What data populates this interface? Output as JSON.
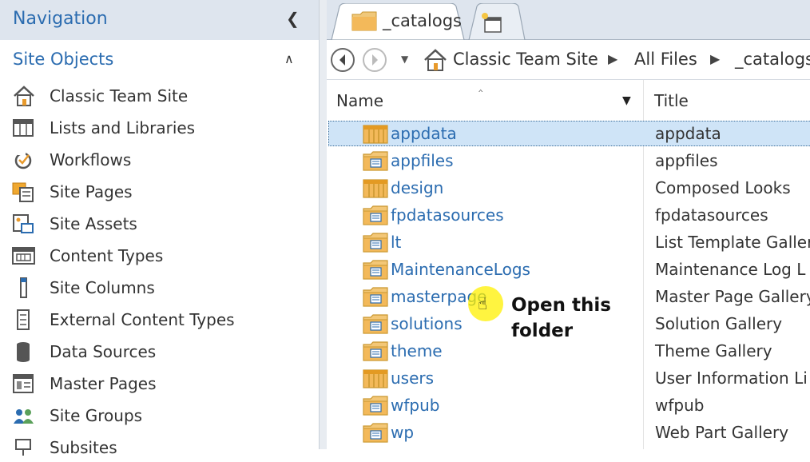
{
  "nav": {
    "title": "Navigation",
    "collapse_icon": "chevron-left-icon",
    "section": "Site Objects",
    "section_icon": "chevron-up-icon",
    "items": [
      {
        "label": "Classic Team Site",
        "icon": "home-icon"
      },
      {
        "label": "Lists and Libraries",
        "icon": "list-icon"
      },
      {
        "label": "Workflows",
        "icon": "workflow-icon"
      },
      {
        "label": "Site Pages",
        "icon": "pages-icon"
      },
      {
        "label": "Site Assets",
        "icon": "assets-icon"
      },
      {
        "label": "Content Types",
        "icon": "content-types-icon"
      },
      {
        "label": "Site Columns",
        "icon": "columns-icon"
      },
      {
        "label": "External Content Types",
        "icon": "external-content-icon"
      },
      {
        "label": "Data Sources",
        "icon": "database-icon"
      },
      {
        "label": "Master Pages",
        "icon": "master-pages-icon"
      },
      {
        "label": "Site Groups",
        "icon": "groups-icon"
      },
      {
        "label": "Subsites",
        "icon": "subsites-icon"
      }
    ]
  },
  "tabs": [
    {
      "label": "_catalogs",
      "icon": "folder-icon",
      "active": true
    },
    {
      "label": "",
      "icon": "new-tab-icon",
      "active": false
    }
  ],
  "breadcrumb": [
    "Classic Team Site",
    "All Files",
    "_catalogs"
  ],
  "columns": {
    "name": "Name",
    "title": "Title"
  },
  "rows": [
    {
      "name": "appdata",
      "title": "appdata",
      "icon": "list-folder-icon",
      "selected": true
    },
    {
      "name": "appfiles",
      "title": "appfiles",
      "icon": "library-folder-icon",
      "selected": false
    },
    {
      "name": "design",
      "title": "Composed Looks",
      "icon": "list-folder-icon",
      "selected": false
    },
    {
      "name": "fpdatasources",
      "title": "fpdatasources",
      "icon": "library-folder-icon",
      "selected": false
    },
    {
      "name": "lt",
      "title": "List Template Galler",
      "icon": "library-folder-icon",
      "selected": false
    },
    {
      "name": "MaintenanceLogs",
      "title": "Maintenance Log L",
      "icon": "library-folder-icon",
      "selected": false
    },
    {
      "name": "masterpage",
      "title": "Master Page Gallery",
      "icon": "library-folder-icon",
      "selected": false
    },
    {
      "name": "solutions",
      "title": "Solution Gallery",
      "icon": "library-folder-icon",
      "selected": false
    },
    {
      "name": "theme",
      "title": "Theme Gallery",
      "icon": "library-folder-icon",
      "selected": false
    },
    {
      "name": "users",
      "title": "User Information Li",
      "icon": "list-folder-icon",
      "selected": false
    },
    {
      "name": "wfpub",
      "title": "wfpub",
      "icon": "library-folder-icon",
      "selected": false
    },
    {
      "name": "wp",
      "title": "Web Part Gallery",
      "icon": "library-folder-icon",
      "selected": false
    }
  ],
  "annotation": {
    "text": "Open this folder"
  },
  "colors": {
    "accent": "#2b6cb0",
    "header_bg": "#dee5ee",
    "selection": "#cfe4f7",
    "folder": "#f0a830"
  }
}
